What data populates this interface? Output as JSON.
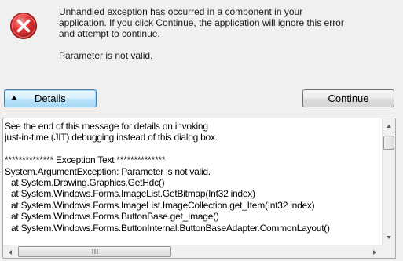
{
  "dialog": {
    "message_lines": [
      "Unhandled exception has occurred in a component in your",
      "application. If you click Continue, the application will ignore this error",
      "and attempt to continue."
    ],
    "error_message": "Parameter is not valid.",
    "icon": "error-icon",
    "icon_color": "#d9282f"
  },
  "buttons": {
    "details_label": "Details",
    "details_icon": "chevron-up-icon",
    "continue_label": "Continue"
  },
  "details": {
    "intro_lines": [
      "See the end of this message for details on invoking",
      "just-in-time (JIT) debugging instead of this dialog box."
    ],
    "section_header": "************** Exception Text **************",
    "exception_line": "System.ArgumentException: Parameter is not valid.",
    "stack_lines": [
      "at System.Drawing.Graphics.GetHdc()",
      "at System.Windows.Forms.ImageList.GetBitmap(Int32 index)",
      "at System.Windows.Forms.ImageList.ImageCollection.get_Item(Int32 index)",
      "at System.Windows.Forms.ButtonBase.get_Image()",
      "at System.Windows.Forms.ButtonInternal.ButtonBaseAdapter.CommonLayout()"
    ],
    "hscroll_grip": "III"
  }
}
